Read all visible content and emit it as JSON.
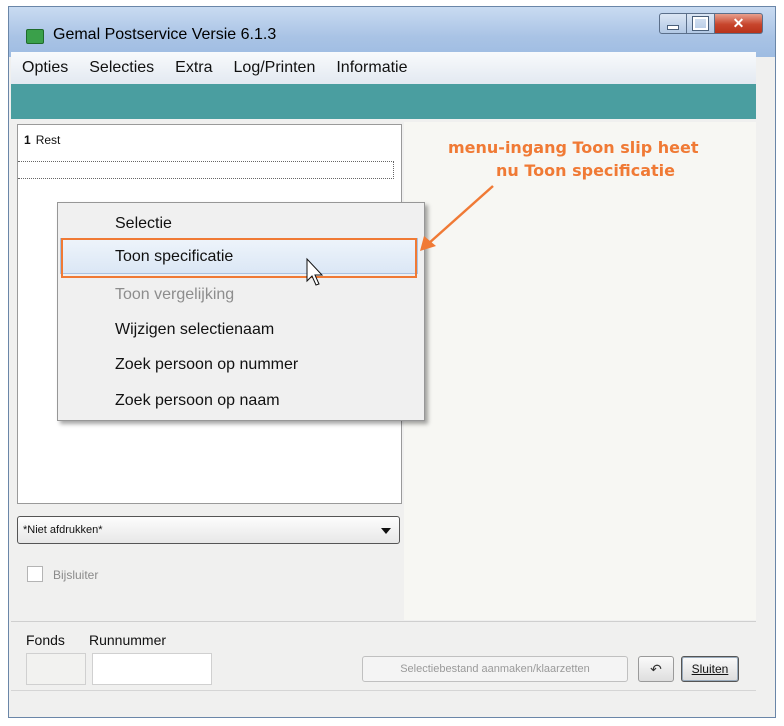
{
  "window": {
    "title": "Gemal Postservice Versie 6.1.3"
  },
  "menu": [
    "Opties",
    "Selecties",
    "Extra",
    "Log/Printen",
    "Informatie"
  ],
  "list": {
    "row_number": "1",
    "row_label": "Rest"
  },
  "context_menu": {
    "items": [
      {
        "label": "Selectie",
        "enabled": true
      },
      {
        "label": "Toon specificatie",
        "enabled": true,
        "highlighted": true
      },
      {
        "label": "Toon vergelijking",
        "enabled": false
      },
      {
        "label": "Wijzigen  selectienaam",
        "enabled": true
      },
      {
        "label": "Zoek persoon op nummer",
        "enabled": true
      },
      {
        "label": "Zoek persoon op naam",
        "enabled": true
      }
    ]
  },
  "print_select": {
    "value": "*Niet afdrukken*"
  },
  "checkbox": {
    "label": "Bijsluiter",
    "checked": false
  },
  "footer": {
    "fonds_label": "Fonds",
    "runnummer_label": "Runnummer",
    "fonds_value": "",
    "runnummer_value": "",
    "selectiebestand_button": "Selectiebestand aanmaken/klaarzetten",
    "undo_button": "↶",
    "close_button": "Sluiten"
  },
  "annotation": {
    "line1": "menu-ingang Toon slip heet",
    "line2": "nu Toon specificatie",
    "color": "#f07a35"
  }
}
